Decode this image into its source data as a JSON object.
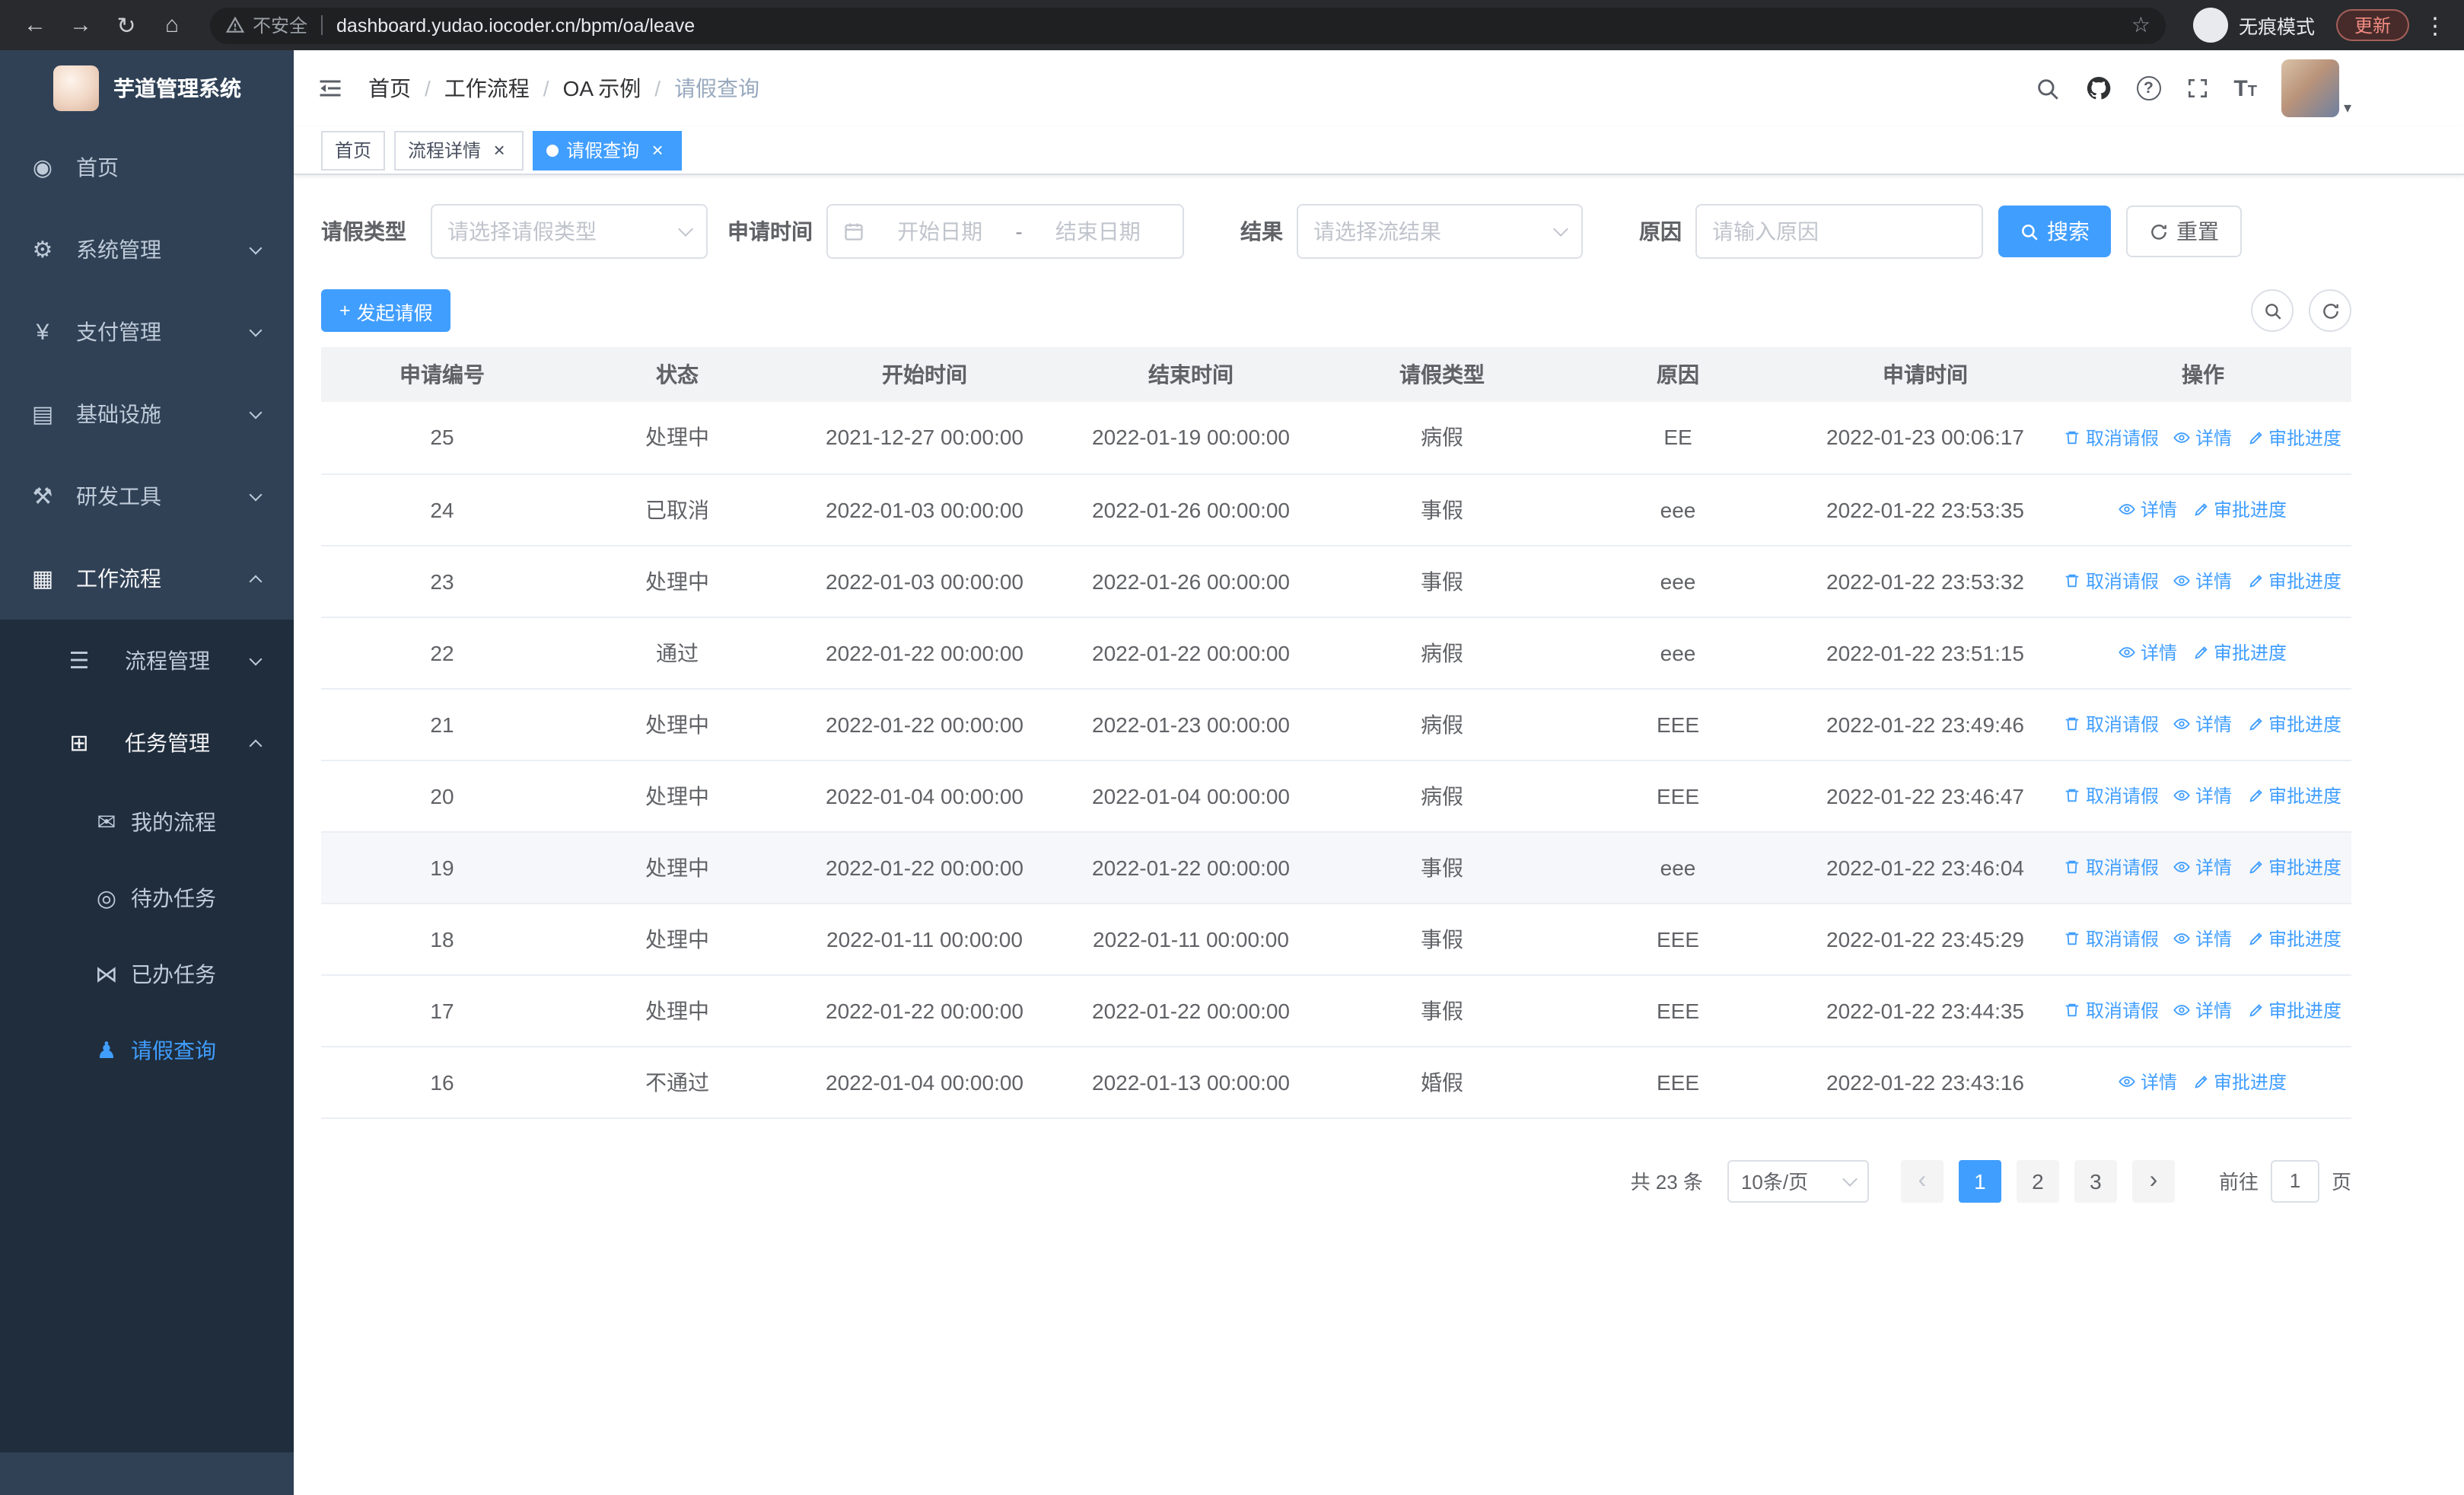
{
  "browser": {
    "security_label": "不安全",
    "url": "dashboard.yudao.iocoder.cn/bpm/oa/leave",
    "incognito_label": "无痕模式",
    "update_label": "更新"
  },
  "sidebar": {
    "logo_title": "芋道管理系统",
    "menu": [
      {
        "label": "首页"
      },
      {
        "label": "系统管理"
      },
      {
        "label": "支付管理"
      },
      {
        "label": "基础设施"
      },
      {
        "label": "研发工具"
      },
      {
        "label": "工作流程"
      }
    ],
    "submenu": [
      {
        "label": "流程管理"
      },
      {
        "label": "任务管理"
      }
    ],
    "task_children": [
      {
        "label": "我的流程"
      },
      {
        "label": "待办任务"
      },
      {
        "label": "已办任务"
      },
      {
        "label": "请假查询"
      }
    ]
  },
  "icons": {
    "home": "◉",
    "system": "⚙",
    "payment": "¥",
    "infrastructure": "▤",
    "devtools": "⚒",
    "workflow": "▦",
    "process": "☰",
    "task": "⊞",
    "my_process": "✉",
    "todo": "◎",
    "done": "⋈",
    "user": "♟",
    "back_arrow": "←",
    "forward_arrow": "→",
    "reload": "↻",
    "home_chrome": "⌂",
    "star": "☆",
    "menu_dots": "⋮",
    "caret_down": "▾",
    "plus": "+",
    "close": "×",
    "prev_arrow": "‹",
    "next_arrow": "›",
    "help": "?"
  },
  "navbar": {
    "breadcrumb": [
      "首页",
      "工作流程",
      "OA 示例",
      "请假查询"
    ]
  },
  "tabs": [
    {
      "label": "首页"
    },
    {
      "label": "流程详情"
    },
    {
      "label": "请假查询"
    }
  ],
  "filters": {
    "leave_type_label": "请假类型",
    "leave_type_placeholder": "请选择请假类型",
    "apply_time_label": "申请时间",
    "start_date_placeholder": "开始日期",
    "range_separator": "-",
    "end_date_placeholder": "结束日期",
    "result_label": "结果",
    "result_placeholder": "请选择流结果",
    "reason_label": "原因",
    "reason_placeholder": "请输入原因",
    "search_label": "搜索",
    "reset_label": "重置"
  },
  "toolbar": {
    "create_label": "发起请假"
  },
  "table": {
    "headers": [
      "申请编号",
      "状态",
      "开始时间",
      "结束时间",
      "请假类型",
      "原因",
      "申请时间",
      "操作"
    ],
    "col_keys": [
      "id",
      "status",
      "start",
      "end",
      "type",
      "reason",
      "applied"
    ],
    "action_labels": {
      "cancel": "取消请假",
      "detail": "详情",
      "progress": "审批进度"
    },
    "rows": [
      {
        "id": "25",
        "status": "处理中",
        "start": "2021-12-27 00:00:00",
        "end": "2022-01-19 00:00:00",
        "type": "病假",
        "reason": "EE",
        "applied": "2022-01-23 00:06:17",
        "actions": [
          "cancel",
          "detail",
          "progress"
        ],
        "hover": false
      },
      {
        "id": "24",
        "status": "已取消",
        "start": "2022-01-03 00:00:00",
        "end": "2022-01-26 00:00:00",
        "type": "事假",
        "reason": "eee",
        "applied": "2022-01-22 23:53:35",
        "actions": [
          "detail",
          "progress"
        ],
        "hover": false
      },
      {
        "id": "23",
        "status": "处理中",
        "start": "2022-01-03 00:00:00",
        "end": "2022-01-26 00:00:00",
        "type": "事假",
        "reason": "eee",
        "applied": "2022-01-22 23:53:32",
        "actions": [
          "cancel",
          "detail",
          "progress"
        ],
        "hover": false
      },
      {
        "id": "22",
        "status": "通过",
        "start": "2022-01-22 00:00:00",
        "end": "2022-01-22 00:00:00",
        "type": "病假",
        "reason": "eee",
        "applied": "2022-01-22 23:51:15",
        "actions": [
          "detail",
          "progress"
        ],
        "hover": false
      },
      {
        "id": "21",
        "status": "处理中",
        "start": "2022-01-22 00:00:00",
        "end": "2022-01-23 00:00:00",
        "type": "病假",
        "reason": "EEE",
        "applied": "2022-01-22 23:49:46",
        "actions": [
          "cancel",
          "detail",
          "progress"
        ],
        "hover": false
      },
      {
        "id": "20",
        "status": "处理中",
        "start": "2022-01-04 00:00:00",
        "end": "2022-01-04 00:00:00",
        "type": "病假",
        "reason": "EEE",
        "applied": "2022-01-22 23:46:47",
        "actions": [
          "cancel",
          "detail",
          "progress"
        ],
        "hover": false
      },
      {
        "id": "19",
        "status": "处理中",
        "start": "2022-01-22 00:00:00",
        "end": "2022-01-22 00:00:00",
        "type": "事假",
        "reason": "eee",
        "applied": "2022-01-22 23:46:04",
        "actions": [
          "cancel",
          "detail",
          "progress"
        ],
        "hover": true
      },
      {
        "id": "18",
        "status": "处理中",
        "start": "2022-01-11 00:00:00",
        "end": "2022-01-11 00:00:00",
        "type": "事假",
        "reason": "EEE",
        "applied": "2022-01-22 23:45:29",
        "actions": [
          "cancel",
          "detail",
          "progress"
        ],
        "hover": false
      },
      {
        "id": "17",
        "status": "处理中",
        "start": "2022-01-22 00:00:00",
        "end": "2022-01-22 00:00:00",
        "type": "事假",
        "reason": "EEE",
        "applied": "2022-01-22 23:44:35",
        "actions": [
          "cancel",
          "detail",
          "progress"
        ],
        "hover": false
      },
      {
        "id": "16",
        "status": "不通过",
        "start": "2022-01-04 00:00:00",
        "end": "2022-01-13 00:00:00",
        "type": "婚假",
        "reason": "EEE",
        "applied": "2022-01-22 23:43:16",
        "actions": [
          "detail",
          "progress"
        ],
        "hover": false
      }
    ]
  },
  "pagination": {
    "total_text": "共 23 条",
    "page_size": "10条/页",
    "pages": [
      "1",
      "2",
      "3"
    ],
    "active_page": "1",
    "goto_label": "前往",
    "goto_value": "1",
    "page_unit": "页"
  }
}
